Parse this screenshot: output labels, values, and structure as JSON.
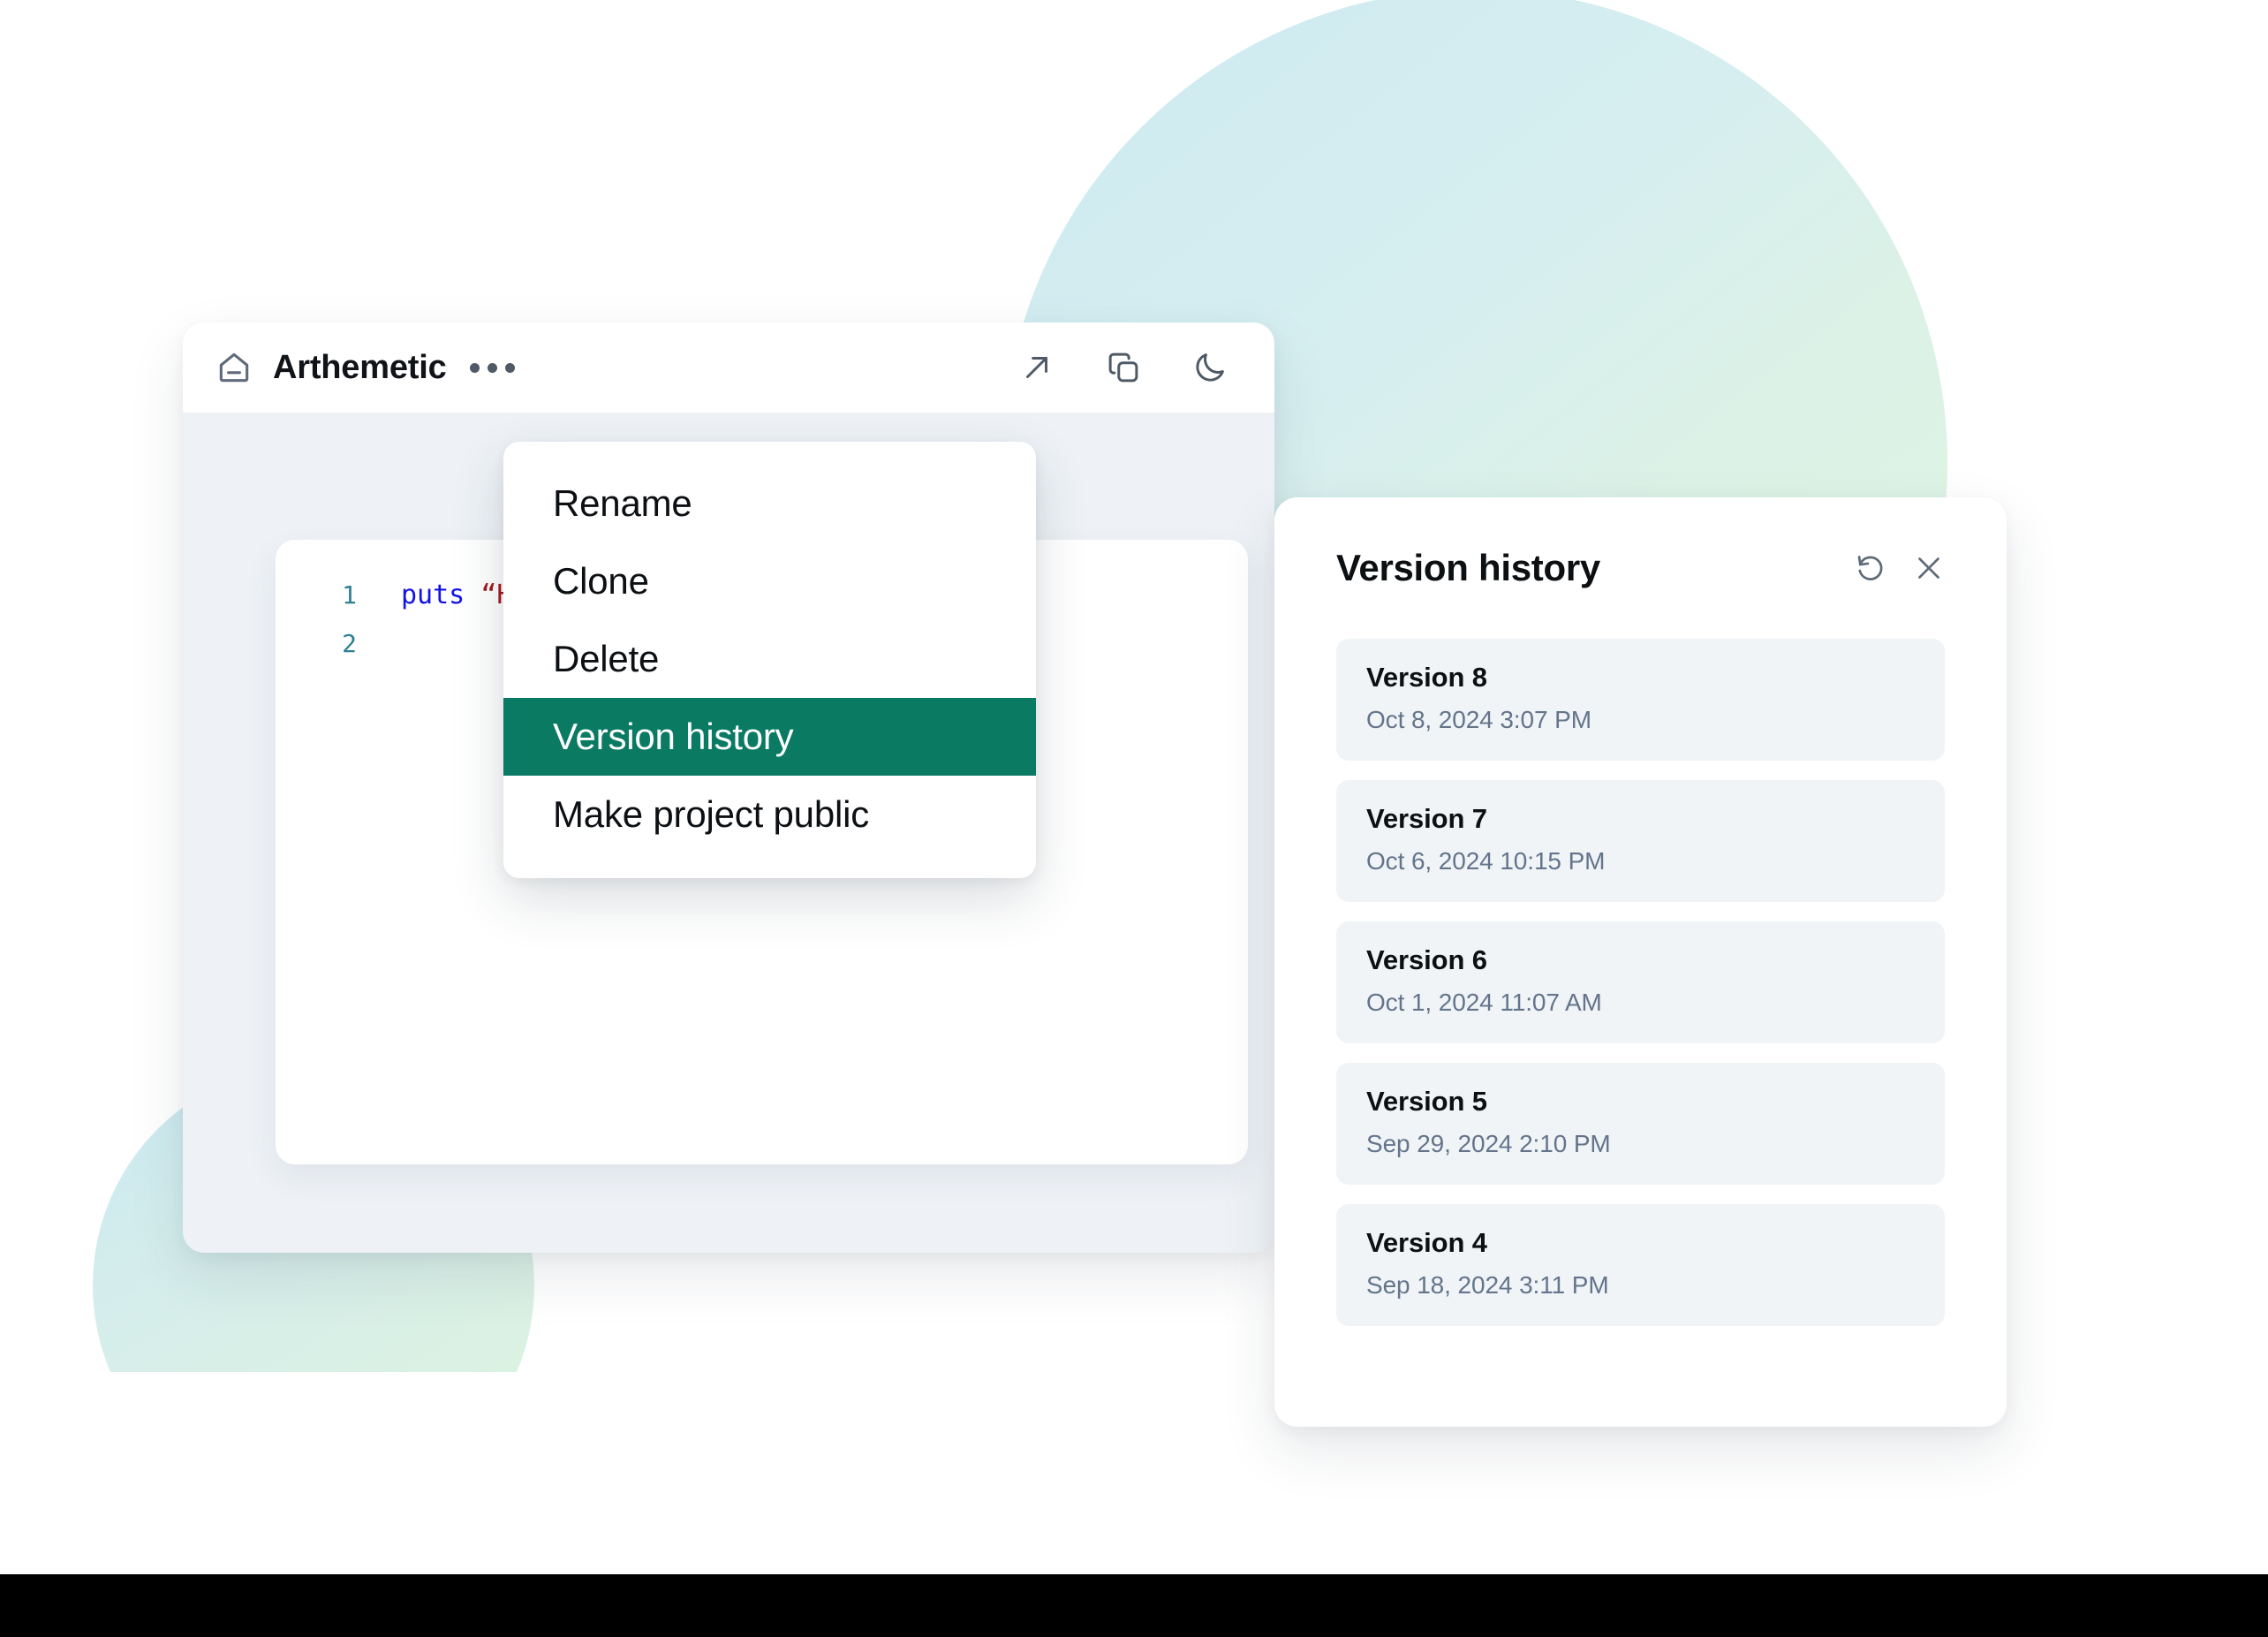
{
  "colors": {
    "accent_green": "#0A7A63",
    "window_body": "#EEF2F6",
    "list_item_bg": "#F0F4F7",
    "icon_gray": "#4E5A66",
    "muted_text": "#64748B",
    "blob_blue": "#CDEAF1",
    "blob_green": "#DFF5E0",
    "bottom_bar": "#000000"
  },
  "editor_window": {
    "title": "Arthemetic",
    "home_icon": "home-icon",
    "kebab_icon": "kebab-menu-icon",
    "actions": [
      {
        "icon": "arrow-up-right-icon",
        "label": "Open in new tab"
      },
      {
        "icon": "copy-icon",
        "label": "Duplicate"
      },
      {
        "icon": "moon-icon",
        "label": "Dark mode"
      }
    ],
    "code": {
      "lines": [
        {
          "number": "1",
          "keyword": "puts",
          "string": "“H"
        },
        {
          "number": "2",
          "keyword": "",
          "string": ""
        }
      ]
    }
  },
  "context_menu": {
    "items": [
      {
        "label": "Rename",
        "selected": false
      },
      {
        "label": "Clone",
        "selected": false
      },
      {
        "label": "Delete",
        "selected": false
      },
      {
        "label": "Version history",
        "selected": true
      },
      {
        "label": "Make project public",
        "selected": false
      }
    ]
  },
  "version_panel": {
    "title": "Version history",
    "actions": [
      {
        "icon": "restore-icon",
        "label": "Restore"
      },
      {
        "icon": "close-icon",
        "label": "Close"
      }
    ],
    "versions": [
      {
        "name": "Version 8",
        "date": "Oct 8, 2024 3:07 PM"
      },
      {
        "name": "Version 7",
        "date": "Oct 6, 2024 10:15 PM"
      },
      {
        "name": "Version 6",
        "date": "Oct 1, 2024 11:07 AM"
      },
      {
        "name": "Version 5",
        "date": "Sep 29, 2024 2:10 PM"
      },
      {
        "name": "Version 4",
        "date": "Sep 18, 2024 3:11 PM"
      }
    ]
  }
}
